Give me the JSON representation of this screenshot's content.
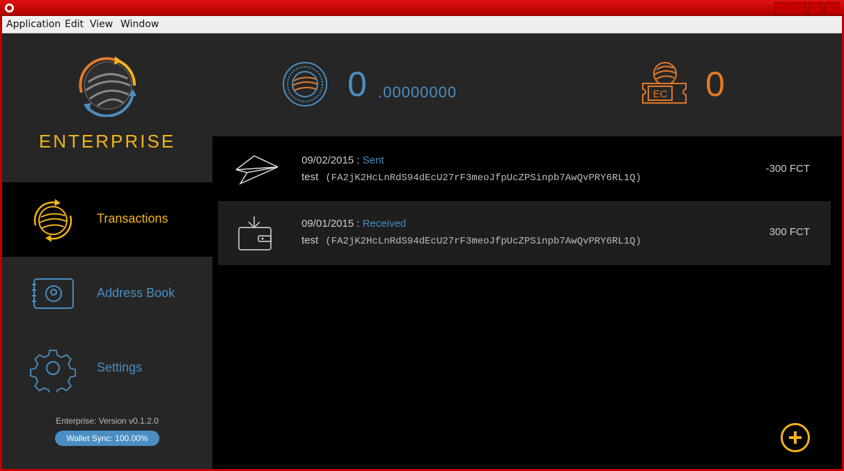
{
  "window": {
    "buttons": [
      "minimize",
      "maximize",
      "restore",
      "close"
    ]
  },
  "menu": [
    "Application",
    "Edit",
    "View",
    "Window"
  ],
  "sidebar": {
    "brand": "ENTERPRISE",
    "items": [
      {
        "label": "Transactions",
        "icon": "transactions-icon",
        "active": true
      },
      {
        "label": "Address Book",
        "icon": "address-book-icon",
        "active": false
      },
      {
        "label": "Settings",
        "icon": "gear-icon",
        "active": false
      }
    ],
    "version": "Enterprise: Version v0.1.2.0",
    "sync": "Wallet Sync: 100.00%"
  },
  "balances": {
    "fct_integer": "0",
    "fct_decimal": ".00000000",
    "ec": "0"
  },
  "transactions": [
    {
      "date": "09/02/2015",
      "status": "Sent",
      "name": "test",
      "address": "(FA2jK2HcLnRdS94dEcU27rF3meoJfpUcZPSinpb7AwQvPRY6RL1Q)",
      "amount": "-300 FCT"
    },
    {
      "date": "09/01/2015",
      "status": "Received",
      "name": "test",
      "address": "(FA2jK2HcLnRdS94dEcU27rF3meoJfpUcZPSinpb7AwQvPRY6RL1Q)",
      "amount": "300 FCT"
    }
  ],
  "colors": {
    "accent": "#f4b41a",
    "blue": "#4a8ec2",
    "orange": "#e07a2a",
    "titlebar": "#c30000"
  }
}
